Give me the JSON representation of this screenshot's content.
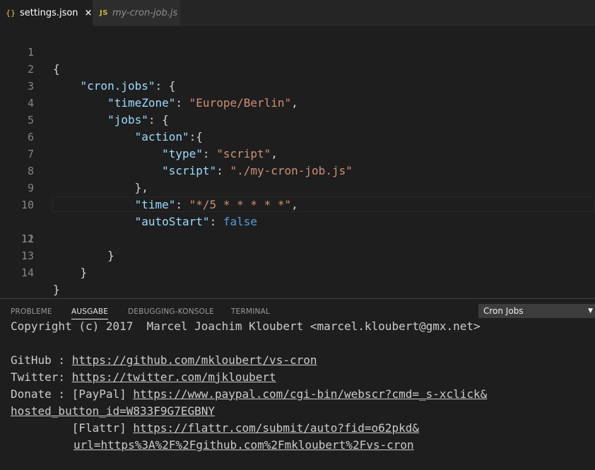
{
  "tabs": [
    {
      "icon": "{}",
      "label": "settings.json",
      "close": "×",
      "active": true
    },
    {
      "icon": "JS",
      "label": "my-cron-job.js",
      "active": false
    }
  ],
  "editor": {
    "line_numbers": [
      "1",
      "2",
      "3",
      "4",
      "5",
      "6",
      "7",
      "8",
      "9",
      "10",
      "11",
      "12",
      "13",
      "14"
    ],
    "lines": [
      [
        "{"
      ],
      [
        "    ",
        "\"cron.jobs\"",
        ": {"
      ],
      [
        "        ",
        "\"timeZone\"",
        ": ",
        "\"Europe/Berlin\"",
        ","
      ],
      [
        "        ",
        "\"jobs\"",
        ": {"
      ],
      [
        "            ",
        "\"action\"",
        ":{"
      ],
      [
        "                ",
        "\"type\"",
        ": ",
        "\"script\"",
        ","
      ],
      [
        "                ",
        "\"script\"",
        ": ",
        "\"./my-cron-job.js\""
      ],
      [
        "            ",
        "},"
      ],
      [
        "            ",
        "\"time\"",
        ": ",
        "\"*/5 * * * * *\"",
        ","
      ],
      [
        "            ",
        "\"autoStart\"",
        ": ",
        "false"
      ],
      [
        ""
      ],
      [
        "        ",
        "}"
      ],
      [
        "    ",
        "}"
      ],
      [
        "}"
      ]
    ]
  },
  "panel": {
    "tabs": [
      "PROBLEME",
      "AUSGABE",
      "DEBUGGING-KONSOLE",
      "TERMINAL"
    ],
    "channel": "Cron Jobs",
    "output": {
      "copyright": "Copyright (c) 2017  Marcel Joachim Kloubert <marcel.kloubert@gmx.net>",
      "github_label": "GitHub : ",
      "github_url": "https://github.com/mkloubert/vs-cron",
      "twitter_label": "Twitter: ",
      "twitter_url": "https://twitter.com/mjkloubert",
      "donate_label": "Donate : [PayPal] ",
      "paypal_url_1": "https://www.paypal.com/cgi-bin/webscr?cmd=_s-xclick&",
      "paypal_url_2": "hosted_button_id=W833F9G7EGBNY",
      "flattr_label": "         [Flattr] ",
      "flattr_url_1": "https://flattr.com/submit/auto?fid=o62pkd&",
      "flattr_url_2": "url=https%3A%2F%2Fgithub.com%2Fmkloubert%2Fvs-cron"
    }
  },
  "colors": {
    "key": "#9cdcfe",
    "string": "#ce9178",
    "boolean": "#569cd6",
    "line_number": "#858585",
    "background": "#1e1e1e"
  }
}
